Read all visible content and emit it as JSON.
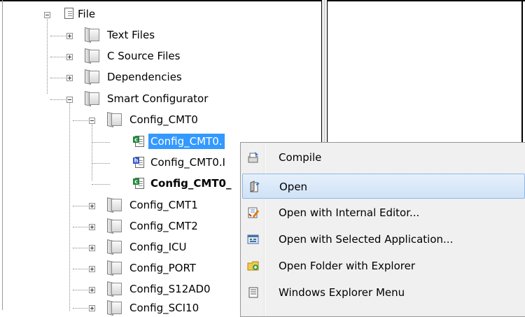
{
  "tree": {
    "root": {
      "label": "File"
    },
    "groups": [
      {
        "label": "Text Files"
      },
      {
        "label": "C Source Files"
      },
      {
        "label": "Dependencies"
      },
      {
        "label": "Smart Configurator"
      }
    ],
    "config_cmt0": {
      "label": "Config_CMT0"
    },
    "cmt0_files": [
      {
        "label": "Config_CMT0.",
        "type": "c"
      },
      {
        "label": "Config_CMT0.I",
        "type": "h"
      },
      {
        "label": "Config_CMT0_",
        "type": "c"
      }
    ],
    "configs": [
      {
        "label": "Config_CMT1"
      },
      {
        "label": "Config_CMT2"
      },
      {
        "label": "Config_ICU"
      },
      {
        "label": "Config_PORT"
      },
      {
        "label": "Config_S12AD0"
      },
      {
        "label": "Config_SCI10"
      }
    ]
  },
  "context_menu": {
    "items": [
      {
        "label": "Compile",
        "icon": "compile-icon"
      },
      {
        "label": "Open",
        "icon": "open-icon",
        "highlighted": true
      },
      {
        "label": "Open with Internal Editor...",
        "icon": "internal-editor-icon"
      },
      {
        "label": "Open with Selected Application...",
        "icon": "selected-application-icon"
      },
      {
        "label": "Open Folder with Explorer",
        "icon": "folder-explorer-icon"
      },
      {
        "label": "Windows Explorer Menu",
        "icon": "explorer-menu-icon"
      }
    ]
  },
  "colors": {
    "selection": "#3399ff",
    "menu_highlight": "#cfe2f7"
  }
}
